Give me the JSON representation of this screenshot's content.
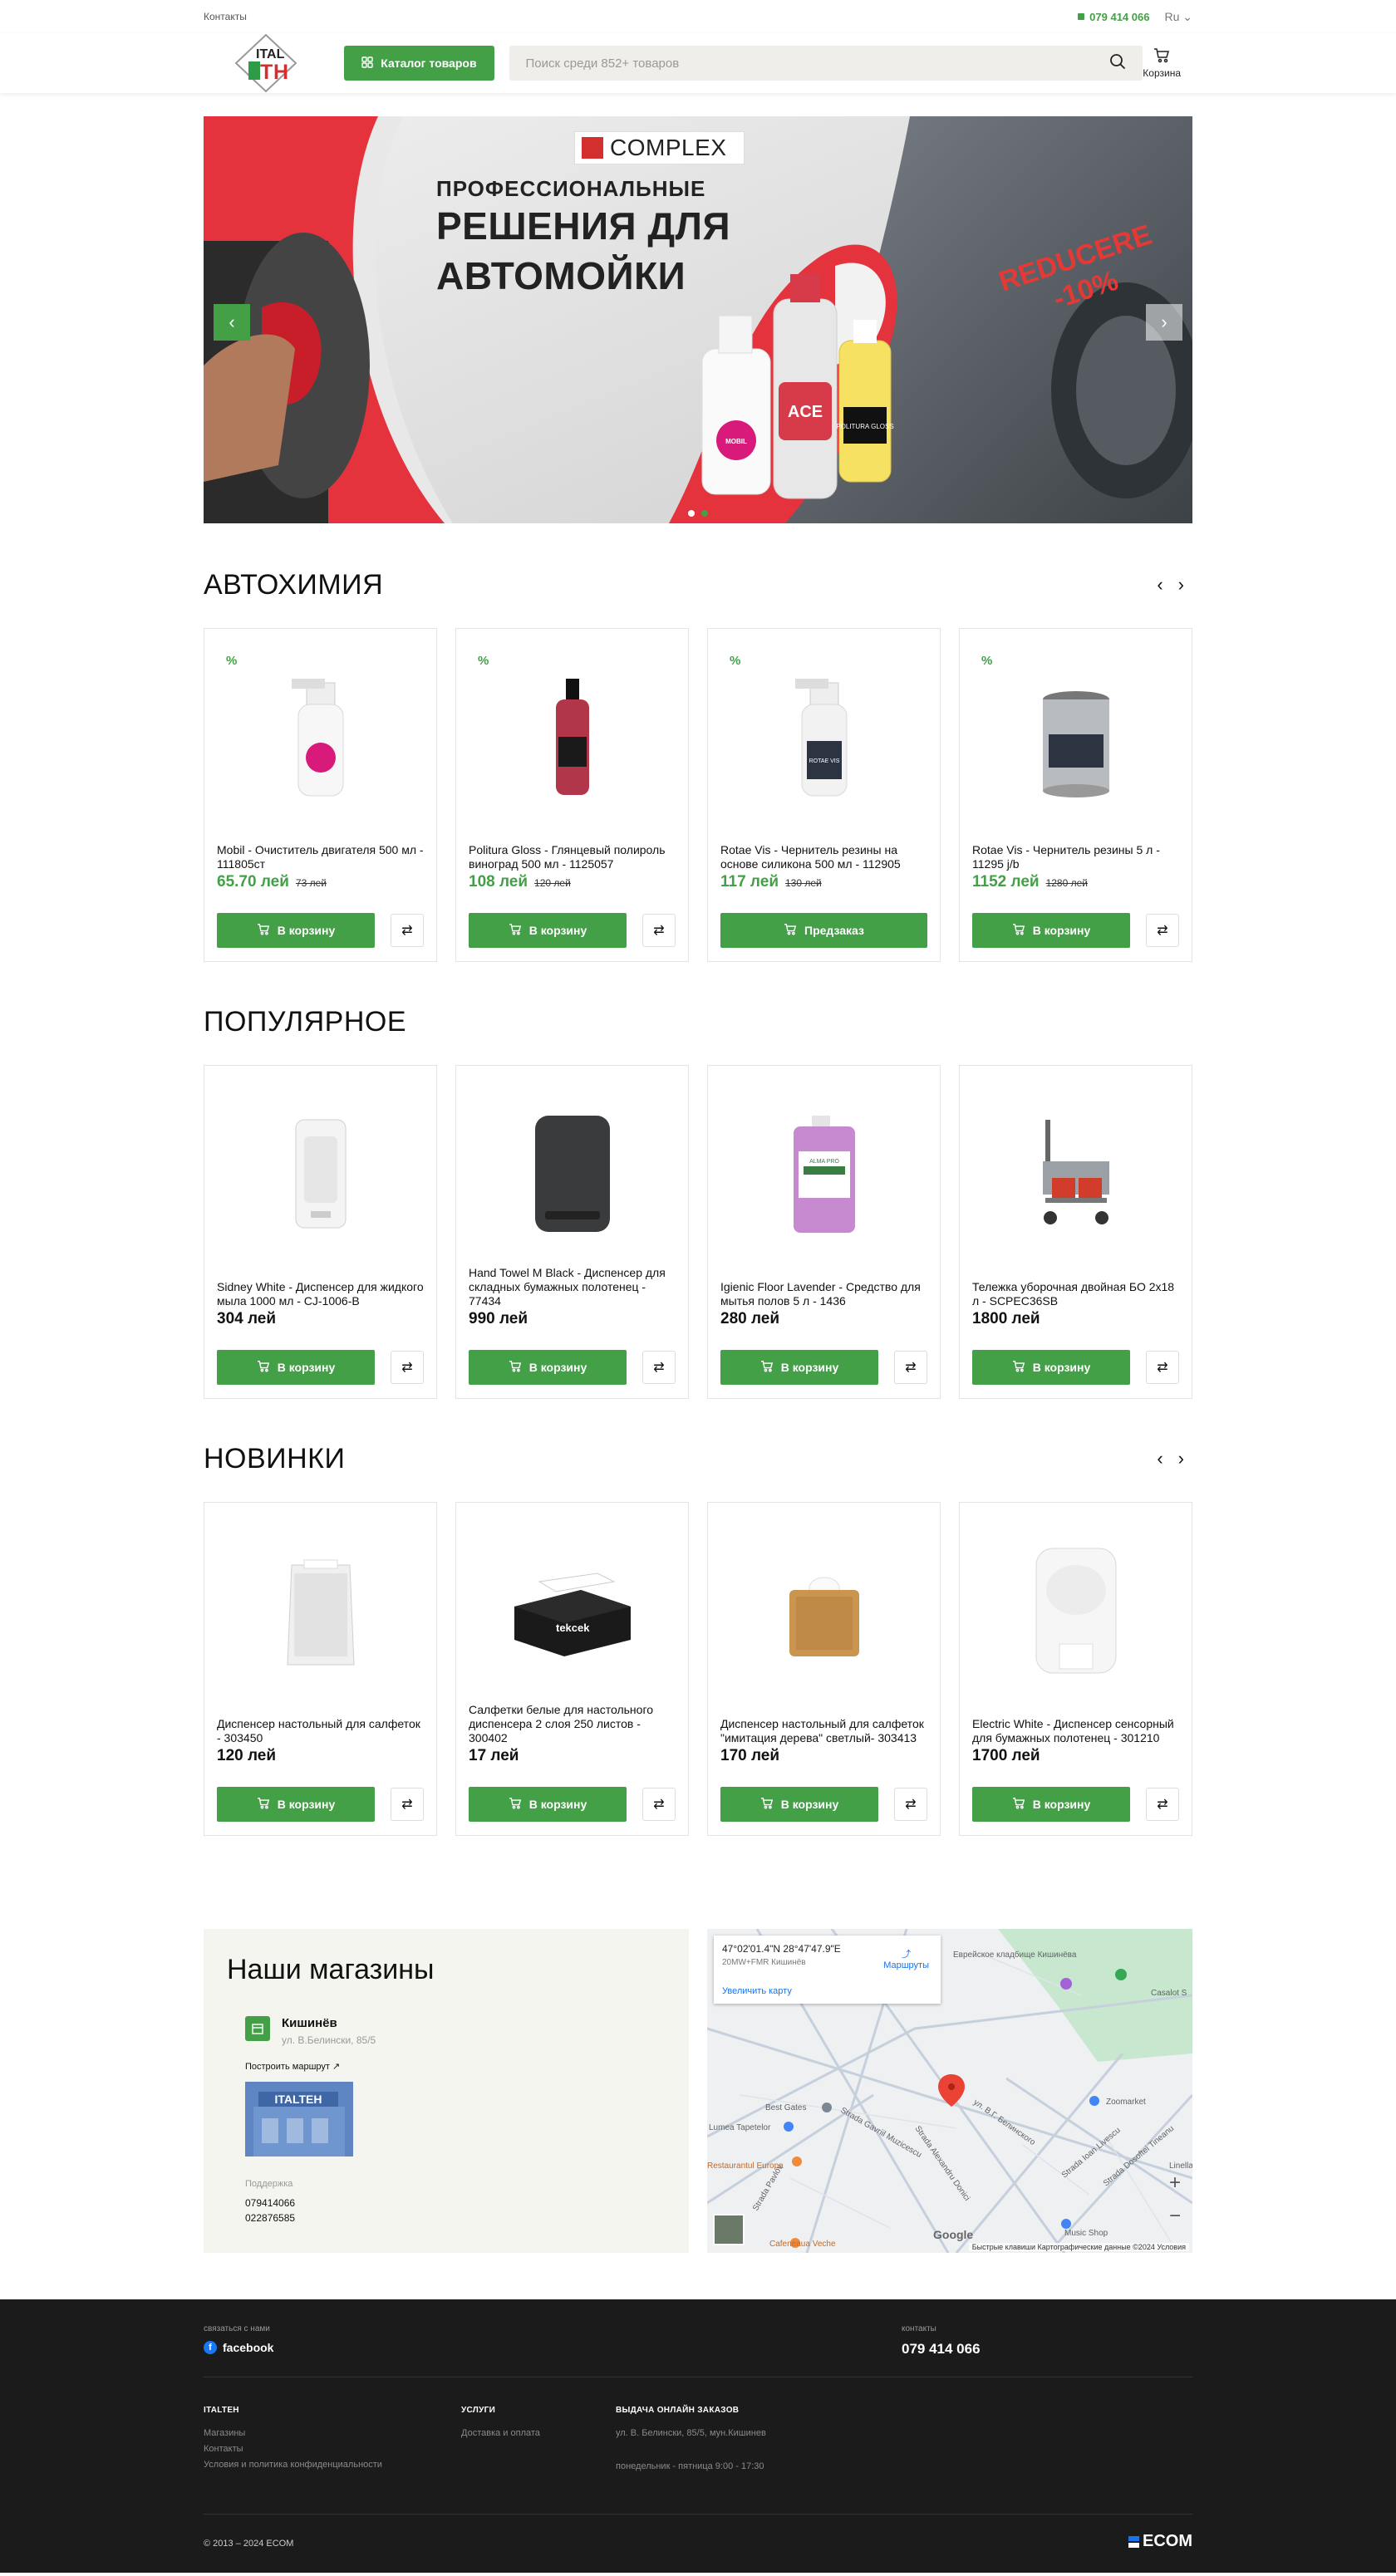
{
  "topbar": {
    "contacts": "Контакты",
    "phone": "079 414 066",
    "lang": "Ru"
  },
  "header": {
    "catalog_label": "Каталог товаров",
    "search_placeholder": "Поиск среди 852+ товаров",
    "cart_label": "Корзина"
  },
  "banner": {
    "brand": "COMPLEX",
    "subtitle": "ПРОФЕССИОНАЛЬНЫЕ",
    "title_line1": "РЕШЕНИЯ ДЛЯ",
    "title_line2": "АВТОМОЙКИ",
    "promo_line1": "REDUCERE",
    "promo_line2": "-10%",
    "labels": [
      "MOBIL",
      "ACE",
      "POLITURA GLOSS"
    ],
    "prev": "‹",
    "next": "›"
  },
  "sections": {
    "autochem": {
      "title": "АВТОХИМИЯ",
      "items": [
        {
          "badge": "%",
          "name": "Mobil - Очиститель двигателя 500 мл - 111805ст",
          "price": "65.70 лей",
          "old": "73 лей",
          "button": "В корзину"
        },
        {
          "badge": "%",
          "name": "Politura Gloss - Глянцевый полироль виноград 500 мл - 1125057",
          "price": "108 лей",
          "old": "120 лей",
          "button": "В корзину"
        },
        {
          "badge": "%",
          "name": "Rotae Vis - Чернитель резины на основе силикона 500 мл - 112905",
          "price": "117 лей",
          "old": "130 лей",
          "button": "Предзаказ"
        },
        {
          "badge": "%",
          "name": "Rotae Vis - Чернитель резины 5 л - 11295 j/b",
          "price": "1152 лей",
          "old": "1280 лей",
          "button": "В корзину"
        }
      ]
    },
    "popular": {
      "title": "ПОПУЛЯРНОЕ",
      "items": [
        {
          "name": "Sidney White - Диспенсер для жидкого мыла 1000 мл - CJ-1006-B",
          "price": "304 лей",
          "button": "В корзину"
        },
        {
          "name": "Hand Towel M Black - Диспенсер для складных бумажных полотенец - 77434",
          "price": "990 лей",
          "button": "В корзину"
        },
        {
          "name": "Igienic Floor Lavender - Средство для мытья полов 5 л - 1436",
          "price": "280 лей",
          "button": "В корзину"
        },
        {
          "name": "Тележка уборочная двойная БО 2x18 л - SCPEC36SB",
          "price": "1800 лей",
          "button": "В корзину"
        }
      ]
    },
    "new": {
      "title": "НОВИНКИ",
      "items": [
        {
          "name": "Диспенсер настольный для салфеток - 303450",
          "price": "120 лей",
          "button": "В корзину"
        },
        {
          "name": "Салфетки белые для настольного диспенсера 2 слоя 250 листов - 300402",
          "price": "17 лей",
          "button": "В корзину"
        },
        {
          "name": "Диспенсер настольный для салфеток \"имитация дерева\" светлый- 303413",
          "price": "170 лей",
          "button": "В корзину"
        },
        {
          "name": "Electric White - Диспенсер сенсорный для бумажных полотенец - 301210",
          "price": "1700 лей",
          "button": "В корзину"
        }
      ]
    }
  },
  "product_labels": [
    "ROTAE VIS",
    "tekcek",
    "ALMA PRO"
  ],
  "stores": {
    "title": "Наши магазины",
    "city": "Кишинёв",
    "address": "ул. В.Белински, 85/5",
    "route": "Построить маршрут",
    "photo_label": "ITALTEH",
    "support_label": "Поддержка",
    "phones": [
      "079414066",
      "022876585"
    ]
  },
  "map": {
    "coords": "47°02'01.4\"N 28°47'47.9\"E",
    "sub": "20MW+FMR Кишинёв",
    "enlarge": "Увеличить карту",
    "directions": "Маршруты",
    "zoom_in": "+",
    "zoom_out": "−",
    "google": "Google",
    "footer_text": "Быстрые клавиши   Картографические данные ©2024   Условия",
    "places": [
      "Best Gates",
      "Zoomarket",
      "Cafeneaua Veche",
      "Music Shop",
      "Еврейское кладбище Кишинёва",
      "Casalot S",
      "Lumea Tapetelor",
      "Restaurantul Europa",
      "Linella"
    ],
    "streets": [
      "ул. В.Г. Белинского",
      "Strada Gavriil Muzicescu",
      "Strada Alexandru Donici",
      "Strada Ioan Livescu",
      "Strada Dosoftei Tineanu",
      "Strada Pavlov"
    ]
  },
  "footer": {
    "contact_label": "связаться с нами",
    "facebook": "facebook",
    "phone_label": "контакты",
    "phone": "079 414 066",
    "col1": {
      "title": "ITALTEH",
      "links": [
        "Магазины",
        "Контакты",
        "Условия и политика конфиденциальности"
      ]
    },
    "col2": {
      "title": "УСЛУГИ",
      "links": [
        "Доставка и оплата"
      ]
    },
    "col3": {
      "title": "ВЫДАЧА ОНЛАЙН ЗАКАЗОВ",
      "lines": [
        "ул. В. Белински, 85/5, мун.Кишинев",
        "понедельник - пятница 9:00 - 17:30"
      ]
    },
    "copyright": "© 2013 – 2024 ECOM",
    "brand": "ECOM"
  },
  "colors": {
    "accent": "#43a047",
    "promo": "#e53935",
    "footer_bg": "#1b1b1b",
    "store_bg": "#f5f5f0"
  }
}
